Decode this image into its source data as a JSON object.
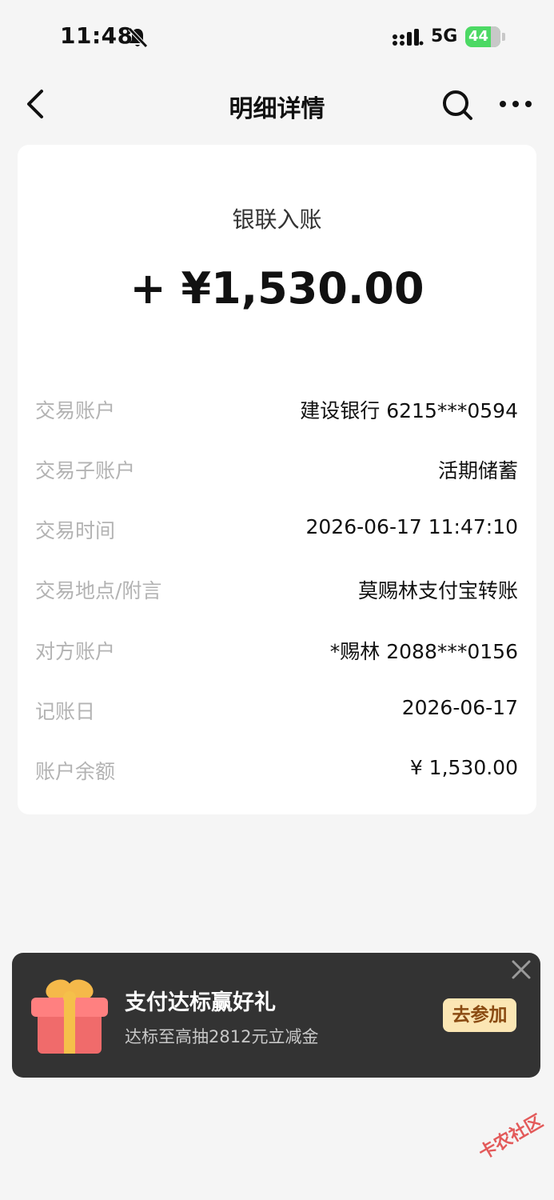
{
  "status_bar": {
    "time": "11:48",
    "network": "5G",
    "battery": "44",
    "battery_color": "#4cd964"
  },
  "nav": {
    "title": "明细详情",
    "back_icon": "chevron-left-icon",
    "search_icon": "search-icon",
    "more_icon": "more-icon"
  },
  "transaction": {
    "type": "银联入账",
    "amount": "+ ¥1,530.00",
    "details": [
      {
        "label": "交易账户",
        "value": "建设银行 6215***0594"
      },
      {
        "label": "交易子账户",
        "value": "活期储蓄"
      },
      {
        "label": "交易时间",
        "value": "2026-06-17 11:47:10"
      },
      {
        "label": "交易地点/附言",
        "value": "莫赐林支付宝转账"
      },
      {
        "label": "对方账户",
        "value": "*赐林 2088***0156"
      },
      {
        "label": "记账日",
        "value": "2026-06-17"
      },
      {
        "label": "账户余额",
        "value": "¥ 1,530.00"
      }
    ]
  },
  "promo": {
    "title": "支付达标赢好礼",
    "subtitle": "达标至高抽2812元立减金",
    "button": "去参加",
    "icon": "gift-icon",
    "close_icon": "close-icon"
  },
  "watermark": {
    "text": "卡农社区"
  }
}
